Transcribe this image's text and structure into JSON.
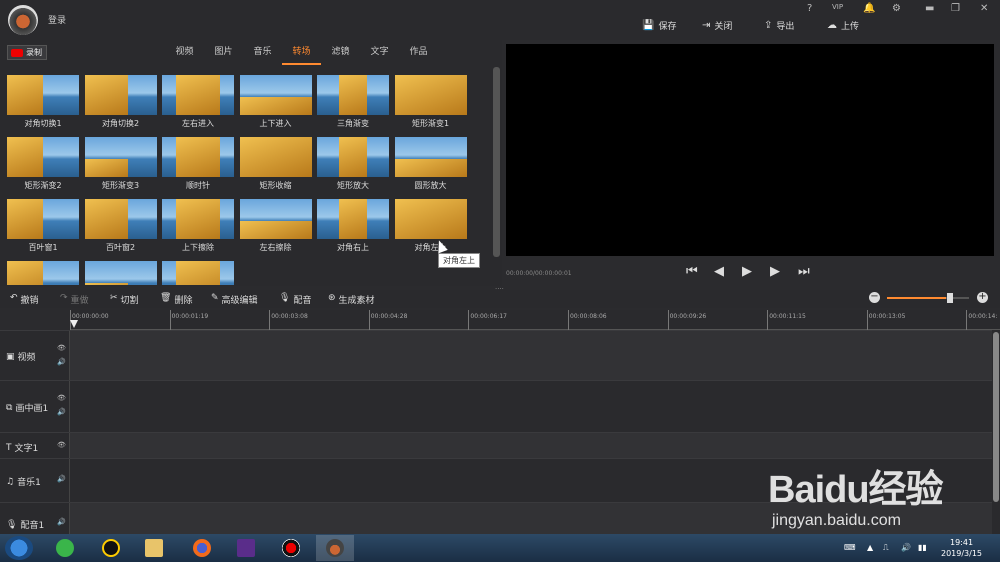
{
  "titlebar": {
    "login": "登录",
    "help": "?",
    "vip": "VIP",
    "save": "保存",
    "close": "关闭",
    "export": "导出",
    "upload": "上传"
  },
  "left": {
    "record": "录制",
    "tabs": [
      "视频",
      "图片",
      "音乐",
      "转场",
      "滤镜",
      "文字",
      "作品"
    ],
    "active_tab": "转场",
    "transitions": [
      "对角切换1",
      "对角切换2",
      "左右进入",
      "上下进入",
      "三角渐变",
      "矩形渐变1",
      "矩形渐变2",
      "矩形渐变3",
      "顺时针",
      "矩形收缩",
      "矩形放大",
      "圆形放大",
      "百叶窗1",
      "百叶窗2",
      "上下擦除",
      "左右擦除",
      "对角右上",
      "对角左上",
      "",
      "",
      ""
    ],
    "tooltip": "对角左上"
  },
  "preview": {
    "time": "00:00:00/00:00:00:01"
  },
  "toolbar": {
    "undo": "撤销",
    "redo": "重做",
    "cut": "切割",
    "delete": "删除",
    "advanced": "高级编辑",
    "dub": "配音",
    "generate": "生成素材"
  },
  "zoom_level": 0.8,
  "ruler": [
    "00:00:00:00",
    "00:00:01:19",
    "00:00:03:08",
    "00:00:04:28",
    "00:00:06:17",
    "00:00:08:06",
    "00:00:09:26",
    "00:00:11:15",
    "00:00:13:05",
    "00:00:14:"
  ],
  "tracks": [
    "视频",
    "画中画1",
    "文字1",
    "音乐1",
    "配音1"
  ],
  "clock": {
    "time": "19:41",
    "date": "2019/3/15"
  },
  "watermark": {
    "brand": "Baidu经验",
    "url": "jingyan.baidu.com"
  }
}
